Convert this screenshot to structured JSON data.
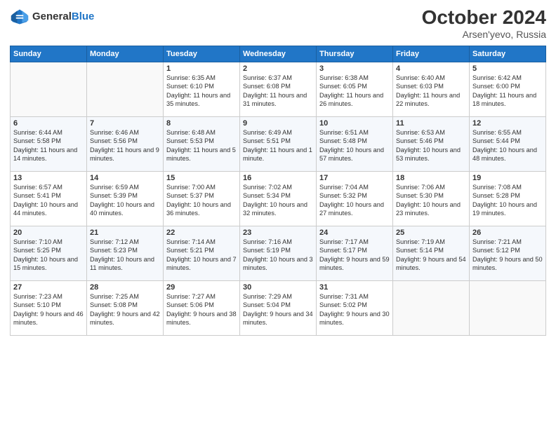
{
  "header": {
    "logo_general": "General",
    "logo_blue": "Blue",
    "month": "October 2024",
    "location": "Arsen'yevo, Russia"
  },
  "days_of_week": [
    "Sunday",
    "Monday",
    "Tuesday",
    "Wednesday",
    "Thursday",
    "Friday",
    "Saturday"
  ],
  "weeks": [
    [
      {
        "day": "",
        "info": ""
      },
      {
        "day": "",
        "info": ""
      },
      {
        "day": "1",
        "info": "Sunrise: 6:35 AM\nSunset: 6:10 PM\nDaylight: 11 hours and 35 minutes."
      },
      {
        "day": "2",
        "info": "Sunrise: 6:37 AM\nSunset: 6:08 PM\nDaylight: 11 hours and 31 minutes."
      },
      {
        "day": "3",
        "info": "Sunrise: 6:38 AM\nSunset: 6:05 PM\nDaylight: 11 hours and 26 minutes."
      },
      {
        "day": "4",
        "info": "Sunrise: 6:40 AM\nSunset: 6:03 PM\nDaylight: 11 hours and 22 minutes."
      },
      {
        "day": "5",
        "info": "Sunrise: 6:42 AM\nSunset: 6:00 PM\nDaylight: 11 hours and 18 minutes."
      }
    ],
    [
      {
        "day": "6",
        "info": "Sunrise: 6:44 AM\nSunset: 5:58 PM\nDaylight: 11 hours and 14 minutes."
      },
      {
        "day": "7",
        "info": "Sunrise: 6:46 AM\nSunset: 5:56 PM\nDaylight: 11 hours and 9 minutes."
      },
      {
        "day": "8",
        "info": "Sunrise: 6:48 AM\nSunset: 5:53 PM\nDaylight: 11 hours and 5 minutes."
      },
      {
        "day": "9",
        "info": "Sunrise: 6:49 AM\nSunset: 5:51 PM\nDaylight: 11 hours and 1 minute."
      },
      {
        "day": "10",
        "info": "Sunrise: 6:51 AM\nSunset: 5:48 PM\nDaylight: 10 hours and 57 minutes."
      },
      {
        "day": "11",
        "info": "Sunrise: 6:53 AM\nSunset: 5:46 PM\nDaylight: 10 hours and 53 minutes."
      },
      {
        "day": "12",
        "info": "Sunrise: 6:55 AM\nSunset: 5:44 PM\nDaylight: 10 hours and 48 minutes."
      }
    ],
    [
      {
        "day": "13",
        "info": "Sunrise: 6:57 AM\nSunset: 5:41 PM\nDaylight: 10 hours and 44 minutes."
      },
      {
        "day": "14",
        "info": "Sunrise: 6:59 AM\nSunset: 5:39 PM\nDaylight: 10 hours and 40 minutes."
      },
      {
        "day": "15",
        "info": "Sunrise: 7:00 AM\nSunset: 5:37 PM\nDaylight: 10 hours and 36 minutes."
      },
      {
        "day": "16",
        "info": "Sunrise: 7:02 AM\nSunset: 5:34 PM\nDaylight: 10 hours and 32 minutes."
      },
      {
        "day": "17",
        "info": "Sunrise: 7:04 AM\nSunset: 5:32 PM\nDaylight: 10 hours and 27 minutes."
      },
      {
        "day": "18",
        "info": "Sunrise: 7:06 AM\nSunset: 5:30 PM\nDaylight: 10 hours and 23 minutes."
      },
      {
        "day": "19",
        "info": "Sunrise: 7:08 AM\nSunset: 5:28 PM\nDaylight: 10 hours and 19 minutes."
      }
    ],
    [
      {
        "day": "20",
        "info": "Sunrise: 7:10 AM\nSunset: 5:25 PM\nDaylight: 10 hours and 15 minutes."
      },
      {
        "day": "21",
        "info": "Sunrise: 7:12 AM\nSunset: 5:23 PM\nDaylight: 10 hours and 11 minutes."
      },
      {
        "day": "22",
        "info": "Sunrise: 7:14 AM\nSunset: 5:21 PM\nDaylight: 10 hours and 7 minutes."
      },
      {
        "day": "23",
        "info": "Sunrise: 7:16 AM\nSunset: 5:19 PM\nDaylight: 10 hours and 3 minutes."
      },
      {
        "day": "24",
        "info": "Sunrise: 7:17 AM\nSunset: 5:17 PM\nDaylight: 9 hours and 59 minutes."
      },
      {
        "day": "25",
        "info": "Sunrise: 7:19 AM\nSunset: 5:14 PM\nDaylight: 9 hours and 54 minutes."
      },
      {
        "day": "26",
        "info": "Sunrise: 7:21 AM\nSunset: 5:12 PM\nDaylight: 9 hours and 50 minutes."
      }
    ],
    [
      {
        "day": "27",
        "info": "Sunrise: 7:23 AM\nSunset: 5:10 PM\nDaylight: 9 hours and 46 minutes."
      },
      {
        "day": "28",
        "info": "Sunrise: 7:25 AM\nSunset: 5:08 PM\nDaylight: 9 hours and 42 minutes."
      },
      {
        "day": "29",
        "info": "Sunrise: 7:27 AM\nSunset: 5:06 PM\nDaylight: 9 hours and 38 minutes."
      },
      {
        "day": "30",
        "info": "Sunrise: 7:29 AM\nSunset: 5:04 PM\nDaylight: 9 hours and 34 minutes."
      },
      {
        "day": "31",
        "info": "Sunrise: 7:31 AM\nSunset: 5:02 PM\nDaylight: 9 hours and 30 minutes."
      },
      {
        "day": "",
        "info": ""
      },
      {
        "day": "",
        "info": ""
      }
    ]
  ]
}
